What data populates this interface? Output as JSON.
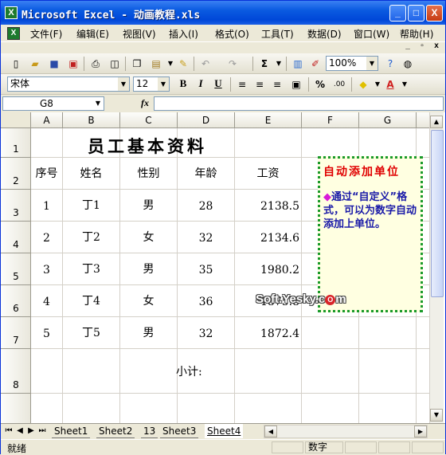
{
  "window": {
    "title": "Microsoft Excel - 动画教程.xls",
    "app_icon": "excel-icon",
    "minimize": "_",
    "maximize": "□",
    "close": "X"
  },
  "menu": [
    "文件(F)",
    "编辑(E)",
    "视图(V)",
    "插入(I)",
    "格式(O)",
    "工具(T)",
    "数据(D)",
    "窗口(W)",
    "帮助(H)"
  ],
  "mdi": {
    "minimize": "_",
    "restore": "▫",
    "close": "x"
  },
  "toolbar_standard": {
    "icons": [
      "new-icon",
      "open-icon",
      "save-icon",
      "permission-icon",
      "print-icon",
      "print-preview-icon",
      "copy-icon",
      "paste-icon",
      "format-painter-icon",
      "undo-icon",
      "redo-icon",
      "autosum-icon",
      "chart-wizard-icon",
      "drawing-icon",
      "help-icon",
      "research-icon"
    ],
    "zoom": "100%",
    "autosum_glyph": "Σ"
  },
  "toolbar_format": {
    "font": "宋体",
    "size": "12",
    "bold": "B",
    "italic": "I",
    "underline": "U",
    "percent": "%"
  },
  "formula_bar": {
    "name_box": "G8",
    "fx": "fx",
    "content": ""
  },
  "grid": {
    "columns": [
      "A",
      "B",
      "C",
      "D",
      "E",
      "F",
      "G"
    ],
    "rows": [
      "1",
      "2",
      "3",
      "4",
      "5",
      "6",
      "7",
      "8"
    ],
    "title": "员工基本资料",
    "headers": [
      "序号",
      "姓名",
      "性别",
      "年龄",
      "工资"
    ],
    "records": [
      [
        "1",
        "丁1",
        "男",
        "28",
        "2138.5"
      ],
      [
        "2",
        "丁2",
        "女",
        "32",
        "2134.6"
      ],
      [
        "3",
        "丁3",
        "男",
        "35",
        "1980.2"
      ],
      [
        "4",
        "丁4",
        "女",
        "36",
        "1875.8"
      ],
      [
        "5",
        "丁5",
        "男",
        "32",
        "1872.4"
      ]
    ],
    "subtotal_label": "小计:"
  },
  "comment": {
    "title": "自动添加单位",
    "bullet": "◆",
    "body": "通过“自定义”格式，可以为数字自动添加上单位。"
  },
  "watermark": {
    "text": "Soft.Yesky.c",
    "mark": "O",
    "suffix": "m"
  },
  "sheet_tabs": [
    "Sheet1",
    "Sheet2",
    "13",
    "Sheet3",
    "Sheet4"
  ],
  "active_sheet": "Sheet4",
  "status": {
    "ready": "就绪",
    "mode": "数字"
  },
  "colors": {
    "comment_title": "#e00000",
    "comment_body": "#1a1aa8",
    "comment_border": "#1a9a2a",
    "titlebar": "#0a5ae0"
  }
}
